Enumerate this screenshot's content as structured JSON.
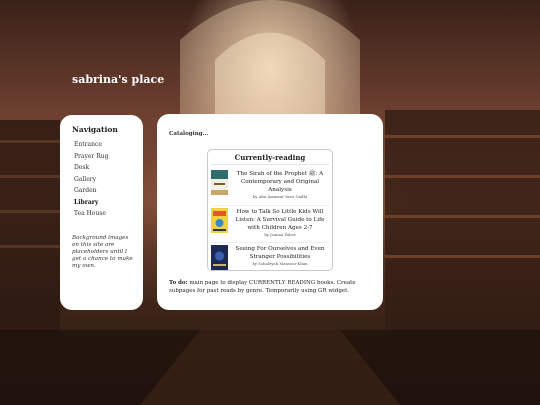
{
  "site": {
    "title": "sabrina's place"
  },
  "sidebar": {
    "heading": "Navigation",
    "items": [
      {
        "label": "Entrance",
        "active": false
      },
      {
        "label": "Prayer Rug",
        "active": false
      },
      {
        "label": "Desk",
        "active": false
      },
      {
        "label": "Gallery",
        "active": false
      },
      {
        "label": "Garden",
        "active": false
      },
      {
        "label": "Library",
        "active": true
      },
      {
        "label": "Tea House",
        "active": false
      }
    ],
    "note": "Background images on this site are placeholders until I get a chance to make my own."
  },
  "main": {
    "status": "Cataloging...",
    "widget": {
      "title": "Currently-reading",
      "books": [
        {
          "title": "The Sirah of the Prophet ﷺ: A Contemporary and Original Analysis",
          "author": "by Abu Ammaar Yasir Qadhi"
        },
        {
          "title": "How to Talk So Little Kids Will Listen: A Survival Guide to Life with Children Ages 2-7",
          "author": "by Joanna Faber"
        },
        {
          "title": "Seeing For Ourselves and Even Stranger Possibilities",
          "author": "by Sohaleyah Mansoor-Khan"
        }
      ]
    },
    "todo": {
      "label": "To do:",
      "text": "main page to display CURRENTLY READING books. Create subpages for past reads by genre. Temporarily using GR widget."
    }
  },
  "colors": {
    "background": "#6d4030",
    "panel": "#ffffff"
  },
  "background_image": "library-hall-scene"
}
